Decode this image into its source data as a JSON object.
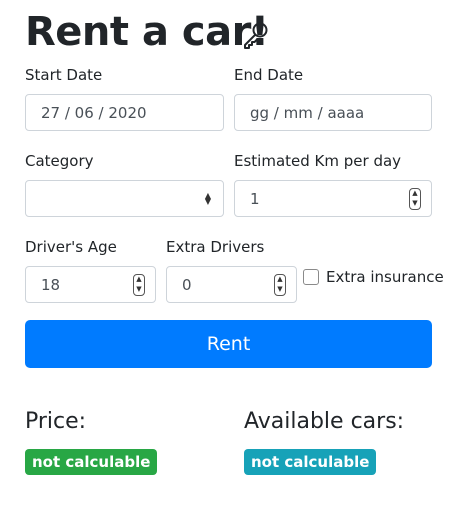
{
  "header": {
    "title": "Rent a car!",
    "icon": "key-icon"
  },
  "form": {
    "start_date": {
      "label": "Start Date",
      "value": "27 / 06 / 2020"
    },
    "end_date": {
      "label": "End Date",
      "placeholder": "gg / mm / aaaa"
    },
    "category": {
      "label": "Category",
      "value": ""
    },
    "km_per_day": {
      "label": "Estimated Km per day",
      "value": "1"
    },
    "drivers_age": {
      "label": "Driver's Age",
      "value": "18"
    },
    "extra_drivers": {
      "label": "Extra Drivers",
      "value": "0"
    },
    "extra_insurance": {
      "label": "Extra insurance",
      "checked": false
    }
  },
  "actions": {
    "rent_label": "Rent"
  },
  "results": {
    "price": {
      "heading": "Price:",
      "status": "not calculable",
      "color": "#28a745"
    },
    "available": {
      "heading": "Available cars:",
      "status": "not calculable",
      "color": "#17a2b8"
    }
  },
  "colors": {
    "primary": "#007bff",
    "success": "#28a745",
    "info": "#17a2b8"
  }
}
